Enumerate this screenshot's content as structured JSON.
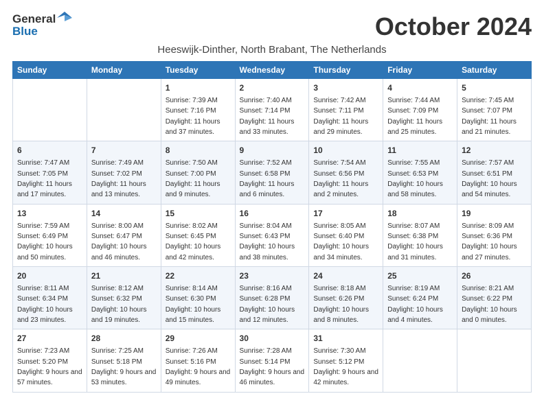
{
  "logo": {
    "line1": "General",
    "line2": "Blue"
  },
  "title": "October 2024",
  "subtitle": "Heeswijk-Dinther, North Brabant, The Netherlands",
  "weekdays": [
    "Sunday",
    "Monday",
    "Tuesday",
    "Wednesday",
    "Thursday",
    "Friday",
    "Saturday"
  ],
  "weeks": [
    [
      {
        "day": "",
        "info": ""
      },
      {
        "day": "",
        "info": ""
      },
      {
        "day": "1",
        "info": "Sunrise: 7:39 AM\nSunset: 7:16 PM\nDaylight: 11 hours and 37 minutes."
      },
      {
        "day": "2",
        "info": "Sunrise: 7:40 AM\nSunset: 7:14 PM\nDaylight: 11 hours and 33 minutes."
      },
      {
        "day": "3",
        "info": "Sunrise: 7:42 AM\nSunset: 7:11 PM\nDaylight: 11 hours and 29 minutes."
      },
      {
        "day": "4",
        "info": "Sunrise: 7:44 AM\nSunset: 7:09 PM\nDaylight: 11 hours and 25 minutes."
      },
      {
        "day": "5",
        "info": "Sunrise: 7:45 AM\nSunset: 7:07 PM\nDaylight: 11 hours and 21 minutes."
      }
    ],
    [
      {
        "day": "6",
        "info": "Sunrise: 7:47 AM\nSunset: 7:05 PM\nDaylight: 11 hours and 17 minutes."
      },
      {
        "day": "7",
        "info": "Sunrise: 7:49 AM\nSunset: 7:02 PM\nDaylight: 11 hours and 13 minutes."
      },
      {
        "day": "8",
        "info": "Sunrise: 7:50 AM\nSunset: 7:00 PM\nDaylight: 11 hours and 9 minutes."
      },
      {
        "day": "9",
        "info": "Sunrise: 7:52 AM\nSunset: 6:58 PM\nDaylight: 11 hours and 6 minutes."
      },
      {
        "day": "10",
        "info": "Sunrise: 7:54 AM\nSunset: 6:56 PM\nDaylight: 11 hours and 2 minutes."
      },
      {
        "day": "11",
        "info": "Sunrise: 7:55 AM\nSunset: 6:53 PM\nDaylight: 10 hours and 58 minutes."
      },
      {
        "day": "12",
        "info": "Sunrise: 7:57 AM\nSunset: 6:51 PM\nDaylight: 10 hours and 54 minutes."
      }
    ],
    [
      {
        "day": "13",
        "info": "Sunrise: 7:59 AM\nSunset: 6:49 PM\nDaylight: 10 hours and 50 minutes."
      },
      {
        "day": "14",
        "info": "Sunrise: 8:00 AM\nSunset: 6:47 PM\nDaylight: 10 hours and 46 minutes."
      },
      {
        "day": "15",
        "info": "Sunrise: 8:02 AM\nSunset: 6:45 PM\nDaylight: 10 hours and 42 minutes."
      },
      {
        "day": "16",
        "info": "Sunrise: 8:04 AM\nSunset: 6:43 PM\nDaylight: 10 hours and 38 minutes."
      },
      {
        "day": "17",
        "info": "Sunrise: 8:05 AM\nSunset: 6:40 PM\nDaylight: 10 hours and 34 minutes."
      },
      {
        "day": "18",
        "info": "Sunrise: 8:07 AM\nSunset: 6:38 PM\nDaylight: 10 hours and 31 minutes."
      },
      {
        "day": "19",
        "info": "Sunrise: 8:09 AM\nSunset: 6:36 PM\nDaylight: 10 hours and 27 minutes."
      }
    ],
    [
      {
        "day": "20",
        "info": "Sunrise: 8:11 AM\nSunset: 6:34 PM\nDaylight: 10 hours and 23 minutes."
      },
      {
        "day": "21",
        "info": "Sunrise: 8:12 AM\nSunset: 6:32 PM\nDaylight: 10 hours and 19 minutes."
      },
      {
        "day": "22",
        "info": "Sunrise: 8:14 AM\nSunset: 6:30 PM\nDaylight: 10 hours and 15 minutes."
      },
      {
        "day": "23",
        "info": "Sunrise: 8:16 AM\nSunset: 6:28 PM\nDaylight: 10 hours and 12 minutes."
      },
      {
        "day": "24",
        "info": "Sunrise: 8:18 AM\nSunset: 6:26 PM\nDaylight: 10 hours and 8 minutes."
      },
      {
        "day": "25",
        "info": "Sunrise: 8:19 AM\nSunset: 6:24 PM\nDaylight: 10 hours and 4 minutes."
      },
      {
        "day": "26",
        "info": "Sunrise: 8:21 AM\nSunset: 6:22 PM\nDaylight: 10 hours and 0 minutes."
      }
    ],
    [
      {
        "day": "27",
        "info": "Sunrise: 7:23 AM\nSunset: 5:20 PM\nDaylight: 9 hours and 57 minutes."
      },
      {
        "day": "28",
        "info": "Sunrise: 7:25 AM\nSunset: 5:18 PM\nDaylight: 9 hours and 53 minutes."
      },
      {
        "day": "29",
        "info": "Sunrise: 7:26 AM\nSunset: 5:16 PM\nDaylight: 9 hours and 49 minutes."
      },
      {
        "day": "30",
        "info": "Sunrise: 7:28 AM\nSunset: 5:14 PM\nDaylight: 9 hours and 46 minutes."
      },
      {
        "day": "31",
        "info": "Sunrise: 7:30 AM\nSunset: 5:12 PM\nDaylight: 9 hours and 42 minutes."
      },
      {
        "day": "",
        "info": ""
      },
      {
        "day": "",
        "info": ""
      }
    ]
  ]
}
